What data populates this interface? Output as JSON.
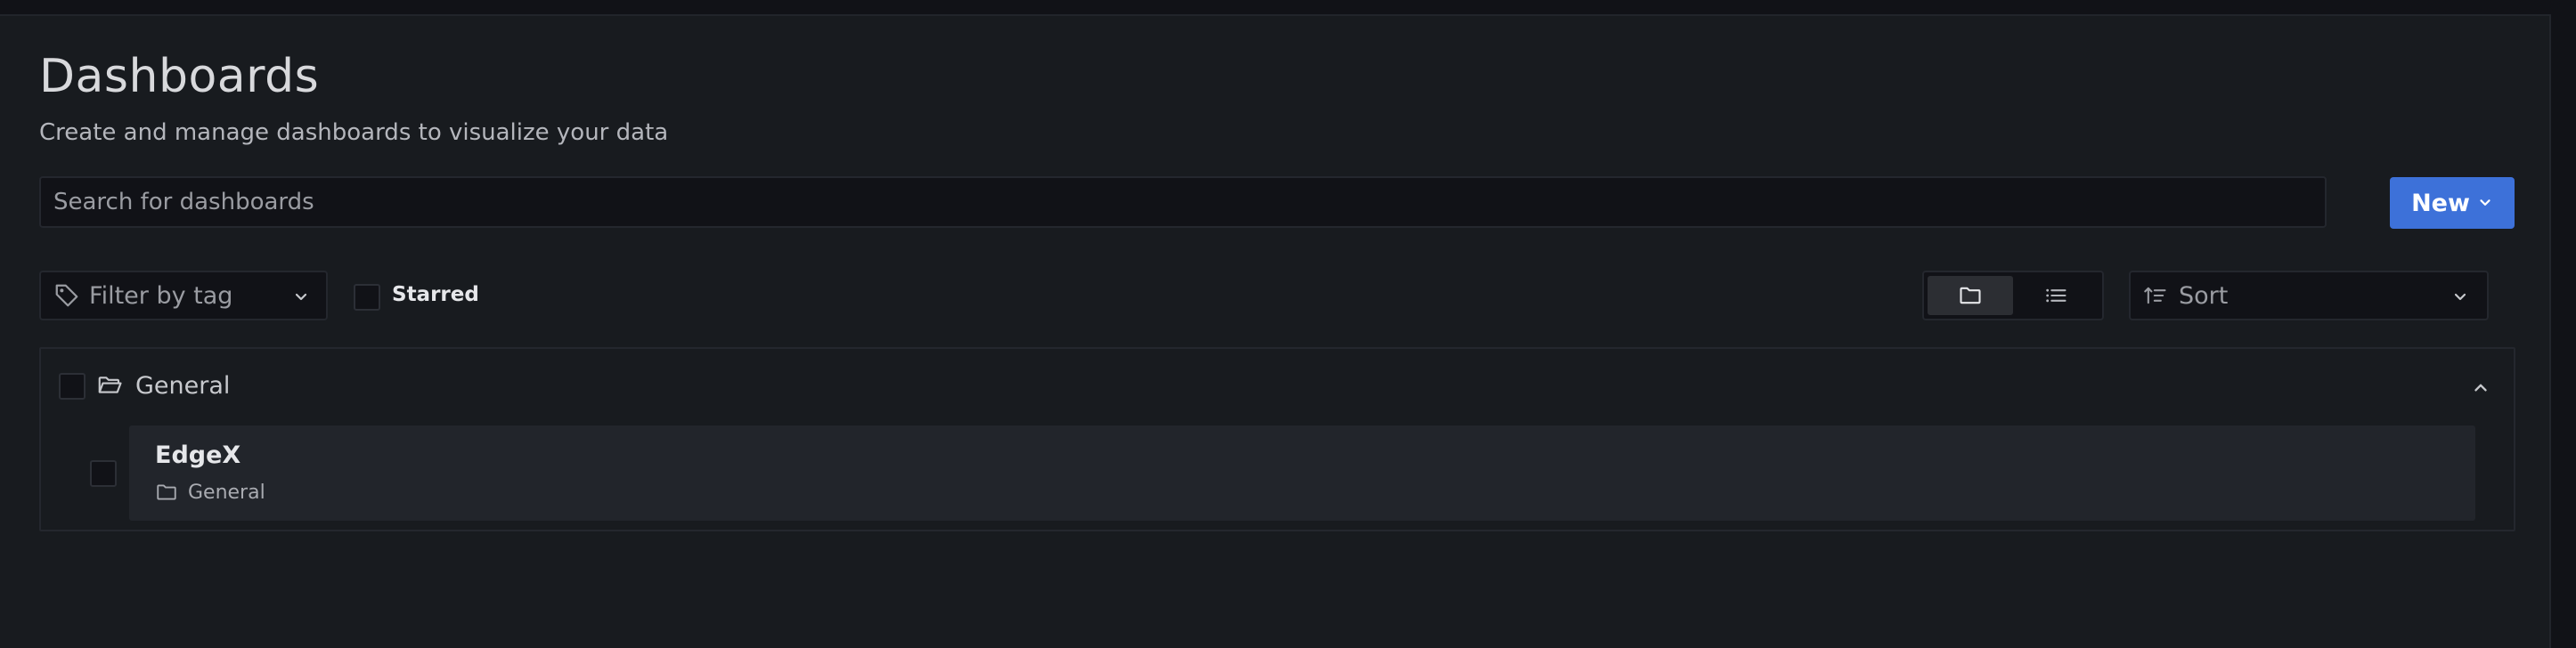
{
  "header": {
    "title": "Dashboards",
    "subtitle": "Create and manage dashboards to visualize your data"
  },
  "search": {
    "placeholder": "Search for dashboards",
    "value": ""
  },
  "actions": {
    "new_label": "New"
  },
  "filters": {
    "tag_placeholder": "Filter by tag",
    "starred_label": "Starred",
    "starred_checked": false,
    "view_mode": "folders",
    "sort_placeholder": "Sort"
  },
  "folders": [
    {
      "name": "General",
      "expanded": true,
      "dashboards": [
        {
          "title": "EdgeX",
          "folder": "General"
        }
      ]
    }
  ],
  "icons": {
    "tag": "tag-icon",
    "chevron": "chevron-down-icon",
    "folder_view": "folder-icon",
    "list_view": "list-icon",
    "sort": "sort-ascending-icon",
    "folder_open": "folder-open-icon",
    "collapse": "chevron-up-icon"
  },
  "colors": {
    "background": "#181b1f",
    "primary_button": "#3d71d9",
    "input_bg": "#111217",
    "row_bg": "#22252b"
  }
}
